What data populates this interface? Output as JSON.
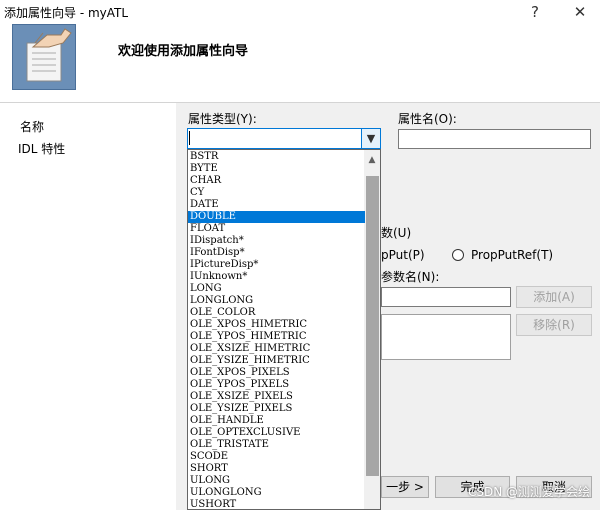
{
  "window": {
    "title": "添加属性向导 - myATL",
    "help_btn": "?",
    "close_btn": "✕"
  },
  "header": {
    "title": "欢迎使用添加属性向导"
  },
  "nav": {
    "items": [
      "名称",
      "IDL 特性"
    ]
  },
  "form": {
    "prop_type_label": "属性类型(Y):",
    "prop_name_label": "属性名(O):",
    "prop_type_value": "",
    "prop_name_value": "",
    "params_label": "数(U)",
    "propput_label": "pPut(P)",
    "propputref_label": "PropPutRef(T)",
    "param_name_label": "参数名(N):",
    "add_button": "添加(A)",
    "remove_button": "移除(R)"
  },
  "dropdown": {
    "options": [
      "BSTR",
      "BYTE",
      "CHAR",
      "CY",
      "DATE",
      "DOUBLE",
      "FLOAT",
      "IDispatch*",
      "IFontDisp*",
      "IPictureDisp*",
      "IUnknown*",
      "LONG",
      "LONGLONG",
      "OLE_COLOR",
      "OLE_XPOS_HIMETRIC",
      "OLE_YPOS_HIMETRIC",
      "OLE_XSIZE_HIMETRIC",
      "OLE_YSIZE_HIMETRIC",
      "OLE_XPOS_PIXELS",
      "OLE_YPOS_PIXELS",
      "OLE_XSIZE_PIXELS",
      "OLE_YSIZE_PIXELS",
      "OLE_HANDLE",
      "OLE_OPTEXCLUSIVE",
      "OLE_TRISTATE",
      "SCODE",
      "SHORT",
      "ULONG",
      "ULONGLONG",
      "USHORT"
    ],
    "selected": "DOUBLE"
  },
  "footer": {
    "next_button": "一步 >",
    "finish_button": "完成",
    "cancel_button": "取消"
  },
  "watermark": "CSDN @测测爱学会绘",
  "colors": {
    "selection": "#0078d7",
    "dialog_bg": "#f0f0f0",
    "header_icon": "#6b8fb7"
  }
}
